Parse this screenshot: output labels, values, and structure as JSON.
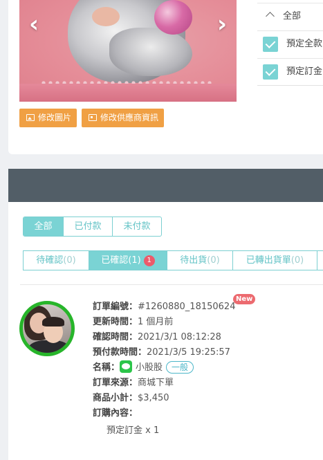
{
  "product": {
    "prev_icon": "chevron-left-icon",
    "next_icon": "chevron-right-icon",
    "edit_photo_label": "修改圖片",
    "edit_supplier_label": "修改供應商資訊"
  },
  "filter_panel": {
    "all_label": "全部",
    "items": [
      {
        "label": "預定全款",
        "checked": true
      },
      {
        "label": "預定訂金",
        "checked": true
      }
    ]
  },
  "payment_tabs": [
    "全部",
    "已付款",
    "未付款"
  ],
  "status_tabs": [
    {
      "label": "待確認",
      "count": "(0)"
    },
    {
      "label": "已確認",
      "count": "(1)",
      "badge": "1"
    },
    {
      "label": "待出貨",
      "count": "(0)"
    },
    {
      "label": "已轉出貨單",
      "count": "(0)"
    }
  ],
  "order": {
    "id_label": "訂單編號：",
    "id_value": "#1260880_18150624",
    "new_badge": "New",
    "updated_label": "更新時間：",
    "updated_value": "1 個月前",
    "confirmed_label": "確認時間：",
    "confirmed_value": "2021/3/1 08:12:28",
    "due_label": "預付款時間：",
    "due_value": "2021/3/5 19:25:57",
    "name_label": "名稱：",
    "name_value": "小股股",
    "name_tag": "一般",
    "source_label": "訂單來源：",
    "source_value": "商城下單",
    "subtotal_label": "商品小計：",
    "subtotal_value": "$3,450",
    "contents_label": "訂購內容：",
    "item_text": "預定訂金 x 1"
  },
  "colors": {
    "accent_teal": "#7ad3d4",
    "orange_button": "#f0a044",
    "header_dark": "#525e67",
    "badge_red": "#ec5a6a",
    "avatar_ring": "#27b52a",
    "line_green": "#2cc54a"
  }
}
